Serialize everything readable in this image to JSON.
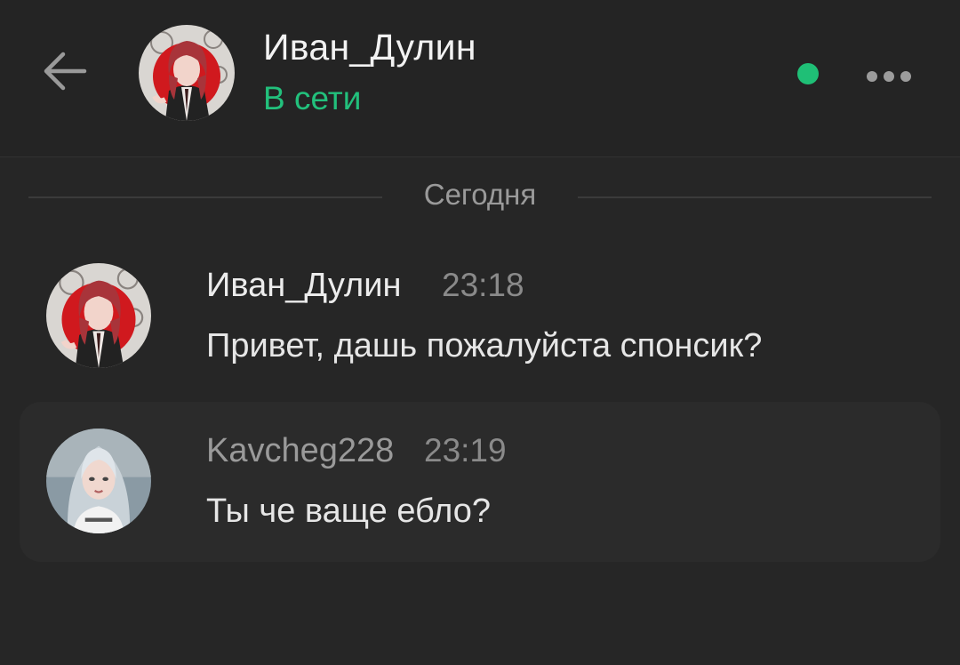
{
  "header": {
    "name": "Иван_Дулин",
    "status": "В сети",
    "status_color": "#22c07c",
    "online_indicator_color": "#1fbf76",
    "back_icon": "arrow-left-icon",
    "more_icon": "more-horizontal-icon"
  },
  "date_divider": {
    "label": "Сегодня"
  },
  "messages": [
    {
      "author": "Иван_Дулин",
      "time": "23:18",
      "text": "Привет, дашь пожалуйста спонсик?",
      "avatar": "anime-character-avatar"
    },
    {
      "author": "Kavcheg228",
      "time": "23:19",
      "text": "Ты че ваще ебло?",
      "avatar": "user-photo-avatar"
    }
  ]
}
